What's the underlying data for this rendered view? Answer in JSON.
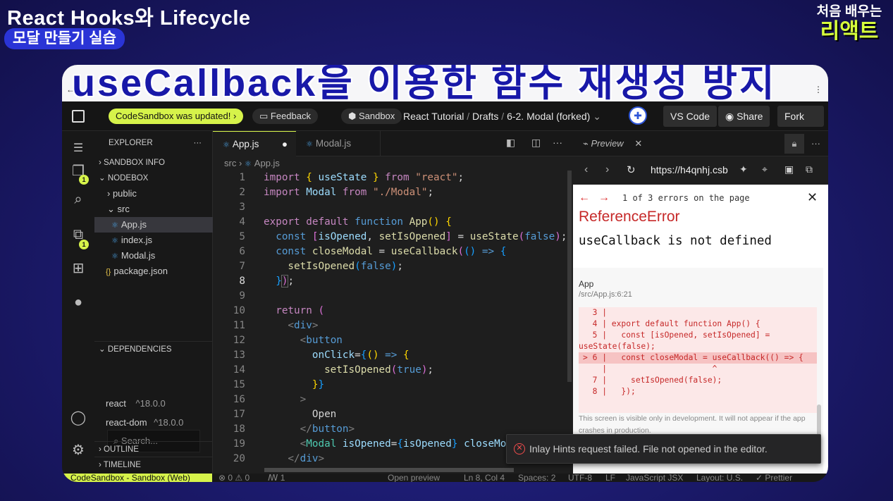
{
  "overlay": {
    "title": "React Hooks와 Lifecycle",
    "subtitle": "모달 만들기 실습",
    "brand_line1": "처음 배우는",
    "brand_line2": "리액트"
  },
  "banner": {
    "text": "useCallback을 이용한 함수 재생성 방지",
    "left_fragment": "←",
    "right_fragment": "⋮"
  },
  "topbar": {
    "updated_pill": "CodeSandbox was updated!  ›",
    "feedback": "Feedback",
    "sandbox": "Sandbox",
    "crumbs": [
      "React Tutorial",
      "Drafts",
      "6-2. Modal (forked)"
    ],
    "vscode": "VS Code",
    "share": "Share",
    "fork": "Fork"
  },
  "explorer": {
    "header": "EXPLORER",
    "sandbox_info": "SANDBOX INFO",
    "nodebox": "NODEBOX",
    "folders": {
      "public": "public",
      "src": "src"
    },
    "files": [
      "App.js",
      "index.js",
      "Modal.js"
    ],
    "package": "package.json",
    "dependencies": "DEPENDENCIES",
    "search_placeholder": "Search...",
    "deps": [
      {
        "name": "react",
        "version": "^18.0.0"
      },
      {
        "name": "react-dom",
        "version": "^18.0.0"
      }
    ],
    "outline": "OUTLINE",
    "timeline": "TIMELINE",
    "badge_count": "1"
  },
  "editor": {
    "tabs": [
      "App.js",
      "Modal.js"
    ],
    "breadcrumb": [
      "src",
      "App.js"
    ],
    "cursor_line": "8"
  },
  "preview": {
    "tab": "Preview",
    "url": "https://h4qnhj.csb",
    "error_count": "1 of 3 errors on the page",
    "error_title": "ReferenceError",
    "error_message": "useCallback is not defined",
    "stack_fn": "App",
    "stack_file": "/src/App.js:6:21",
    "snippet": [
      "  3 |",
      "  4 | export default function App() {",
      "  5 |   const [isOpened, setIsOpened] =",
      "useState(false);",
      "> 6 |   const closeModal = useCallback(() => {",
      "    |                      ^",
      "  7 |     setIsOpened(false);",
      "  8 |   });"
    ],
    "dev_note": "This screen is visible only in development. It will not appear if the app crashes in production."
  },
  "notification": {
    "text": "Inlay Hints request failed. File not opened in the editor."
  },
  "statusbar": {
    "remote": "CodeSandbox - Sandbox (Web)",
    "errors": "⊗ 0  ⚠ 0",
    "ports": "ꟿ 1",
    "open_preview": "Open preview",
    "position": "Ln 8, Col 4",
    "spaces": "Spaces: 2",
    "encoding": "UTF-8",
    "eol": "LF",
    "language": "JavaScript JSX",
    "layout": "Layout: U.S.",
    "prettier": "✓ Prettier"
  },
  "colors": {
    "accent": "#d6f34a",
    "banner_text": "#1818a8",
    "error_red": "#c62828"
  }
}
